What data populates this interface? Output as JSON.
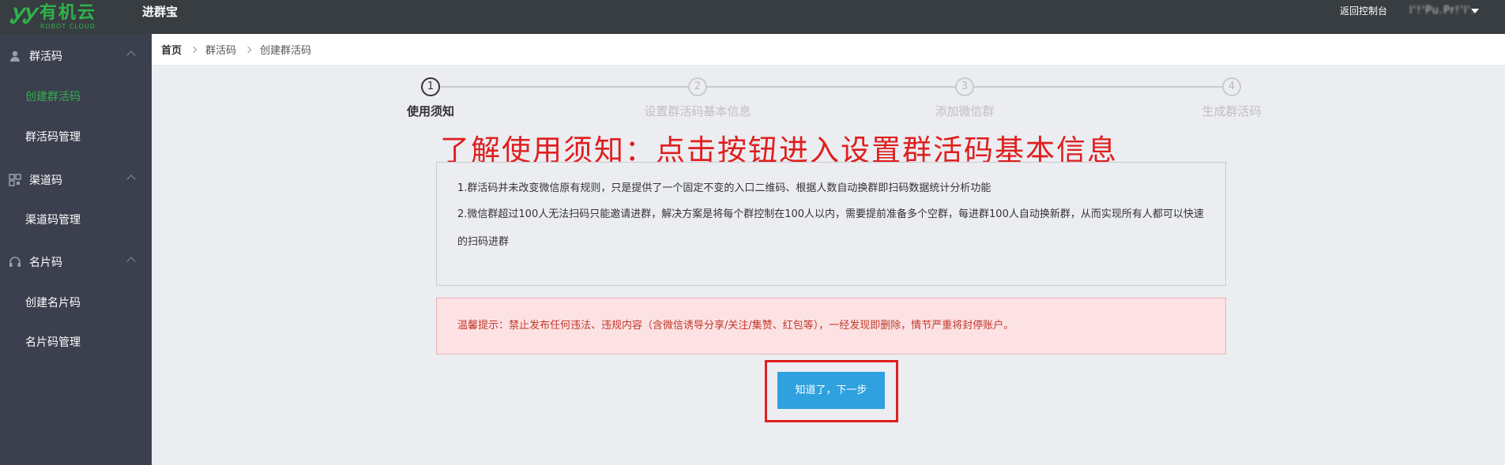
{
  "header": {
    "logo_mark": "ᎩᎩ",
    "logo_cn": "有机云",
    "logo_en": "ROBOT CLOUD",
    "app_title": "进群宝",
    "back_link": "返回控制台",
    "user_name": "l'!'Pu.Pr!'l'."
  },
  "sidebar": {
    "groups": [
      {
        "label": "群活码",
        "icon": "user-icon"
      },
      {
        "label": "渠道码",
        "icon": "qr-grid-icon"
      },
      {
        "label": "名片码",
        "icon": "headset-icon"
      }
    ],
    "items": [
      {
        "label": "创建群活码"
      },
      {
        "label": "群活码管理"
      },
      {
        "label": "渠道码管理"
      },
      {
        "label": "创建名片码"
      },
      {
        "label": "名片码管理"
      }
    ]
  },
  "breadcrumb": [
    "首页",
    "群活码",
    "创建群活码"
  ],
  "steps": [
    {
      "number": "1",
      "label": "使用须知"
    },
    {
      "number": "2",
      "label": "设置群活码基本信息"
    },
    {
      "number": "3",
      "label": "添加微信群"
    },
    {
      "number": "4",
      "label": "生成群活码"
    }
  ],
  "annotation": "了解使用须知：点击按钮进入设置群活码基本信息",
  "info": {
    "line1": "1.群活码并未改变微信原有规则，只是提供了一个固定不变的入口二维码、根据人数自动换群即扫码数据统计分析功能",
    "line2": "2.微信群超过100人无法扫码只能邀请进群，解决方案是将每个群控制在100人以内，需要提前准备多个空群，每进群100人自动换新群，从而实现所有人都可以快速的扫码进群"
  },
  "warning": "温馨提示：禁止发布任何违法、违规内容（含微信诱导分享/关注/集赞、红包等），一经发现即删除，情节严重将封停账户。",
  "next_button": "知道了，下一步",
  "colors": {
    "topbar": "#373d41",
    "sidebar": "#3b3f4e",
    "brand_green": "#2fb34a",
    "primary_button": "#2fa1df",
    "warning_bg": "#fde2e4",
    "annotation_red": "#e01e1e"
  }
}
